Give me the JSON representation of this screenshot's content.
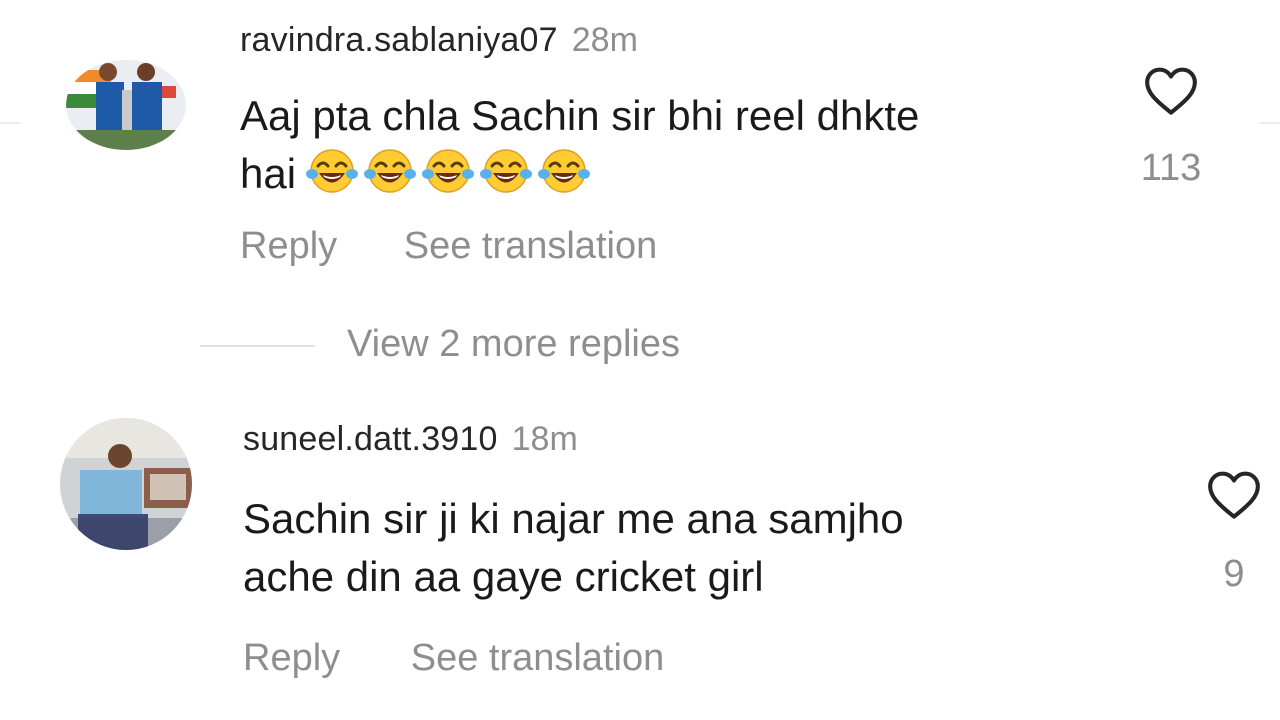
{
  "comments": [
    {
      "username": "ravindra.sablaniya07",
      "time": "28m",
      "text_line1": "Aaj pta chla Sachin sir bhi reel dhkte",
      "text_line2": "hai",
      "emojis": [
        "face-with-tears-of-joy",
        "face-with-tears-of-joy",
        "face-with-tears-of-joy",
        "face-with-tears-of-joy",
        "face-with-tears-of-joy"
      ],
      "like_count": "113",
      "reply_label": "Reply",
      "translate_label": "See translation"
    },
    {
      "username": "suneel.datt.3910",
      "time": "18m",
      "text_line1": "Sachin sir ji ki najar me ana samjho",
      "text_line2": "ache din aa gaye cricket girl",
      "like_count": "9",
      "reply_label": "Reply",
      "translate_label": "See translation"
    }
  ],
  "view_more_replies": "View 2 more replies",
  "colors": {
    "primary_text": "#262626",
    "secondary_text": "#8e8e8e",
    "background": "#ffffff"
  }
}
